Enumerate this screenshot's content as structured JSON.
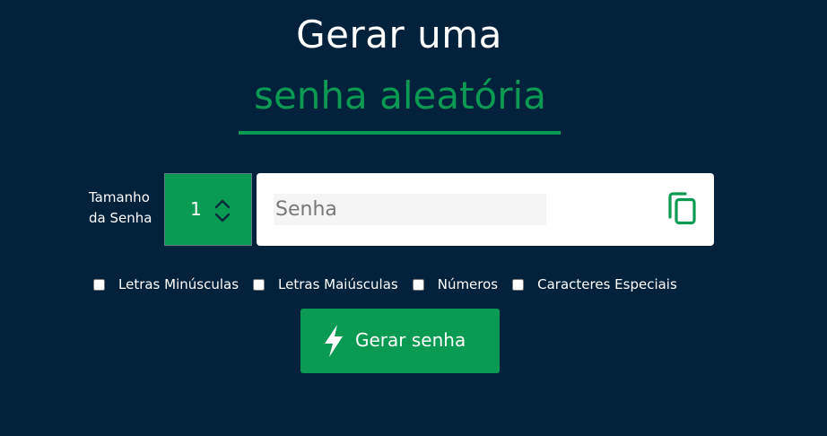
{
  "header": {
    "line1": "Gerar uma",
    "line2": "senha aleatória"
  },
  "size": {
    "label": "Tamanho da Senha",
    "value": "1"
  },
  "password": {
    "placeholder": "Senha",
    "value": ""
  },
  "options": [
    {
      "label": "Letras Minúsculas",
      "checked": false
    },
    {
      "label": "Letras Maiúsculas",
      "checked": false
    },
    {
      "label": "Números",
      "checked": false
    },
    {
      "label": "Caracteres Especiais",
      "checked": false
    }
  ],
  "generate_button": {
    "label": "Gerar senha"
  },
  "icons": {
    "copy": "copy-icon",
    "bolt": "lightning-bolt-icon",
    "spin": "chevron-up-down-icon"
  },
  "colors": {
    "background": "#02213b",
    "accent": "#0b9a52",
    "text": "#ffffff"
  }
}
